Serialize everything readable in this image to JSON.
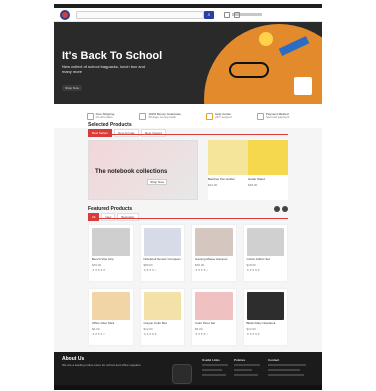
{
  "header": {
    "search_placeholder": ""
  },
  "hero": {
    "title": "It's Back To School",
    "subtitle": "New collect of school bagpacks, lunch box and many more",
    "button": "Shop Now"
  },
  "features": [
    {
      "title": "Free Shipping",
      "subtitle": "On all orders"
    },
    {
      "title": "100% Money Guarantee",
      "subtitle": "30 days money back"
    },
    {
      "title": "Help Center",
      "subtitle": "24/7 support"
    },
    {
      "title": "Payment Method",
      "subtitle": "Secured payment"
    }
  ],
  "selected_products": {
    "title": "Selected Products",
    "tabs": [
      "Best Sellers",
      "New Arrivals",
      "Most Viewed"
    ],
    "banner": {
      "text": "The notebook collections",
      "button": "Shop Now"
    },
    "items": [
      {
        "name": "Bamboo Pen Holder",
        "price": "$22.00"
      },
      {
        "name": "Guitar Stand",
        "price": "$48.00"
      }
    ]
  },
  "featured_products": {
    "title": "Featured Products",
    "tabs": [
      "All",
      "New",
      "Bestseller"
    ],
    "items": [
      {
        "name": "Bench Vise Grip",
        "price": "$45.00",
        "rating": "★★★★★"
      },
      {
        "name": "Notebook Sensor Computer",
        "price": "$89.00",
        "rating": "★★★★☆"
      },
      {
        "name": "Gaming Mouse Hammer",
        "price": "$35.00",
        "rating": "★★★★☆"
      },
      {
        "name": "Cotton Fabric Set",
        "price": "$18.00",
        "rating": "★★★★★"
      },
      {
        "name": "Office Glue Stick",
        "price": "$6.00",
        "rating": "★★★★☆"
      },
      {
        "name": "Crayon Color Box",
        "price": "$12.00",
        "rating": "★★★★★"
      },
      {
        "name": "Color Pens Set",
        "price": "$9.00",
        "rating": "★★★★☆"
      },
      {
        "name": "Black Diary Notebook",
        "price": "$14.00",
        "rating": "★★★★★"
      }
    ]
  },
  "footer": {
    "about_title": "About Us",
    "about_text": "We are a leading online store for school and office supplies.",
    "columns": [
      "Useful Links",
      "Policies",
      "Contact"
    ]
  }
}
